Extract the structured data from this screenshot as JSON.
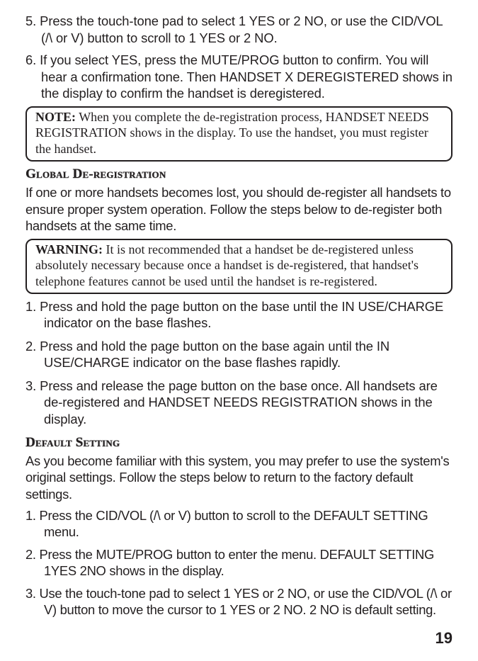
{
  "step5": "5. Press the touch-tone pad to select 1 YES or 2 NO, or use the CID/VOL (/\\ or V) button to scroll to 1 YES or 2 NO.",
  "step6": "6. If you select YES, press the MUTE/PROG button to confirm. You will hear a confirmation tone. Then HANDSET X DEREGISTERED shows in the display to confirm the handset is deregistered.",
  "note": {
    "label": "NOTE:",
    "text": " When you complete the de-registration process, HANDSET NEEDS REGISTRATION shows in the display. To use the handset, you must register the handset."
  },
  "global": {
    "heading": "Global De-registration",
    "intro": "If one or more handsets becomes lost, you should de-register all handsets to ensure proper system operation. Follow the steps below to de-register both handsets at the same time.",
    "warn": {
      "label": "WARNING:",
      "text": " It is not recommended that a handset be de-registered unless absolutely necessary because once a handset is de-registered, that handset's telephone features cannot be used until the handset is re-registered."
    },
    "steps": [
      "1.  Press and hold the page button on the base until the IN USE/CHARGE indicator on the base flashes.",
      "2.  Press and hold the page button on the base again until the IN USE/CHARGE indicator on the base flashes rapidly.",
      "3.  Press and release the page button on the base once. All handsets are de-registered and HANDSET NEEDS REGISTRATION shows in the display."
    ]
  },
  "default": {
    "heading": "Default Setting",
    "intro": "As you become familiar with this system, you may prefer to use the system's original settings. Follow the steps below to return to the factory default settings.",
    "steps": [
      "1.  Press the CID/VOL (/\\ or V) button to scroll to the DEFAULT SETTING menu.",
      "2.  Press the MUTE/PROG button to enter the menu. DEFAULT SETTING 1YES 2NO shows in the display.",
      "3.  Use the touch-tone pad to select 1 YES or 2 NO, or use the CID/VOL (/\\ or V) button to move the cursor to 1 YES or 2 NO. 2 NO is default setting."
    ]
  },
  "page_number": "19"
}
